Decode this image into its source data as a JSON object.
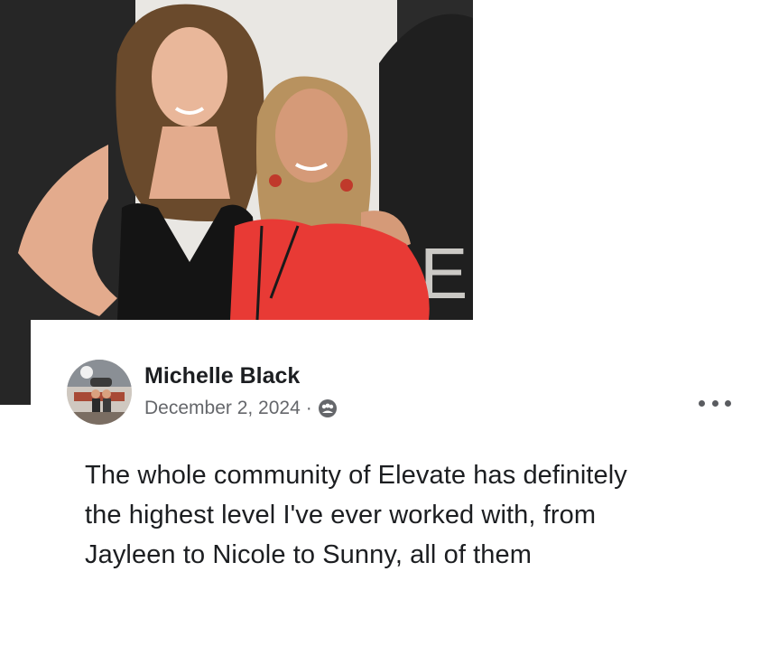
{
  "post": {
    "author_name": "Michelle Black",
    "date": "December 2, 2024",
    "separator": "·",
    "audience_icon": "group-icon",
    "more_icon": "more-options-icon",
    "text": "The whole community of Elevate has definitely the highest level I've ever worked with, from Jayleen to Nicole to Sunny, all of them"
  },
  "photo": {
    "backdrop_letters": "EL"
  },
  "colors": {
    "author": "#1c1e21",
    "meta": "#65676b",
    "red_top": "#e83a35",
    "black_top": "#141414"
  }
}
